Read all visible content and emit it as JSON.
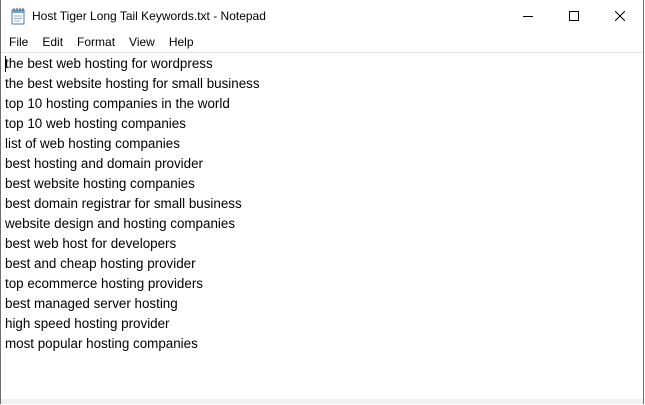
{
  "window": {
    "title": "Host Tiger Long Tail Keywords.txt - Notepad",
    "app_icon": "notepad-icon"
  },
  "menu": {
    "items": [
      {
        "label": "File"
      },
      {
        "label": "Edit"
      },
      {
        "label": "Format"
      },
      {
        "label": "View"
      },
      {
        "label": "Help"
      }
    ]
  },
  "document": {
    "lines": [
      "the best web hosting for wordpress",
      "the best website hosting for small business",
      "top 10 hosting companies in the world",
      "top 10 web hosting companies",
      "list of web hosting companies",
      "best hosting and domain provider",
      "best website hosting companies",
      "best domain registrar for small business",
      "website design and hosting companies",
      "best web host for developers",
      "best and cheap hosting provider",
      "top ecommerce hosting providers",
      "best managed server hosting",
      "high speed hosting provider",
      "most popular hosting companies"
    ]
  },
  "colors": {
    "text": "#000000",
    "background": "#ffffff",
    "border": "#6e6e6e"
  }
}
